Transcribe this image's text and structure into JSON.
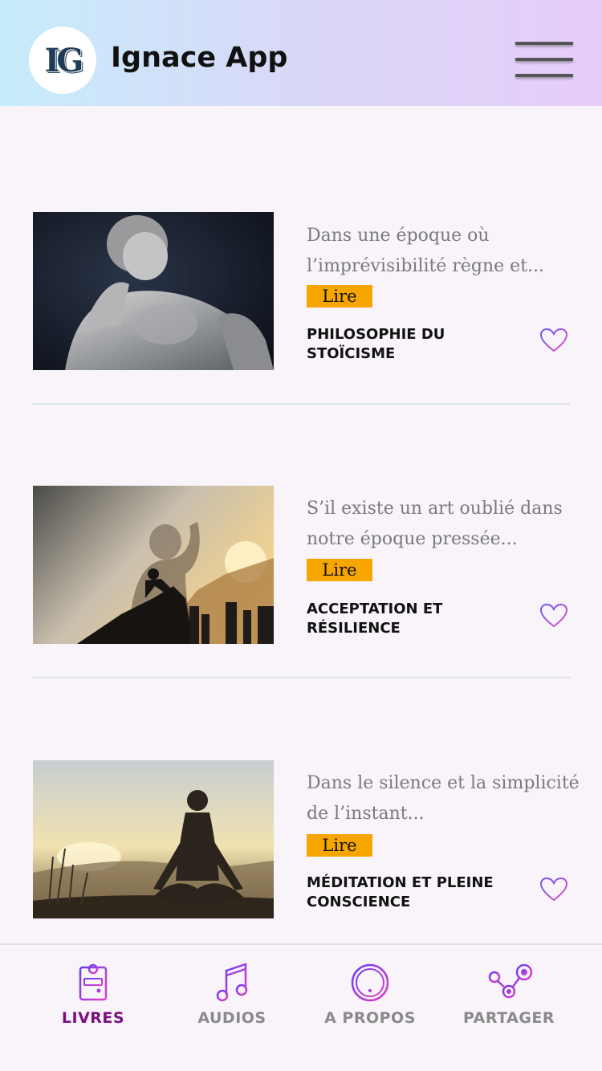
{
  "header": {
    "logo_text": "IG",
    "app_title": "Ignace App"
  },
  "colors": {
    "accent_button": "#f7a600",
    "active_tab": "#7a1080",
    "inactive_tab": "#8a8a8a",
    "icon_gradient": [
      "#6a3df0",
      "#e040c8"
    ]
  },
  "books": [
    {
      "excerpt": "Dans une époque où l’imprévisibilité règne et...",
      "read_label": "Lire",
      "title": "PHILOSOPHIE DU STOÏCISME",
      "image_icon": "statue-photo"
    },
    {
      "excerpt": "S’il existe un art oublié dans notre époque pressée...",
      "read_label": "Lire",
      "title": "ACCEPTATION ET RÉSILIENCE",
      "image_icon": "climber-photo"
    },
    {
      "excerpt": "Dans le silence et la simplicité de l’instant...",
      "read_label": "Lire",
      "title": "MÉDITATION ET PLEINE CONSCIENCE",
      "image_icon": "meditation-photo"
    }
  ],
  "tabs": [
    {
      "label": "LIVRES",
      "icon": "book-icon",
      "active": true
    },
    {
      "label": "AUDIOS",
      "icon": "music-icon",
      "active": false
    },
    {
      "label": "A PROPOS",
      "icon": "info-icon",
      "active": false
    },
    {
      "label": "PARTAGER",
      "icon": "share-icon",
      "active": false
    }
  ]
}
